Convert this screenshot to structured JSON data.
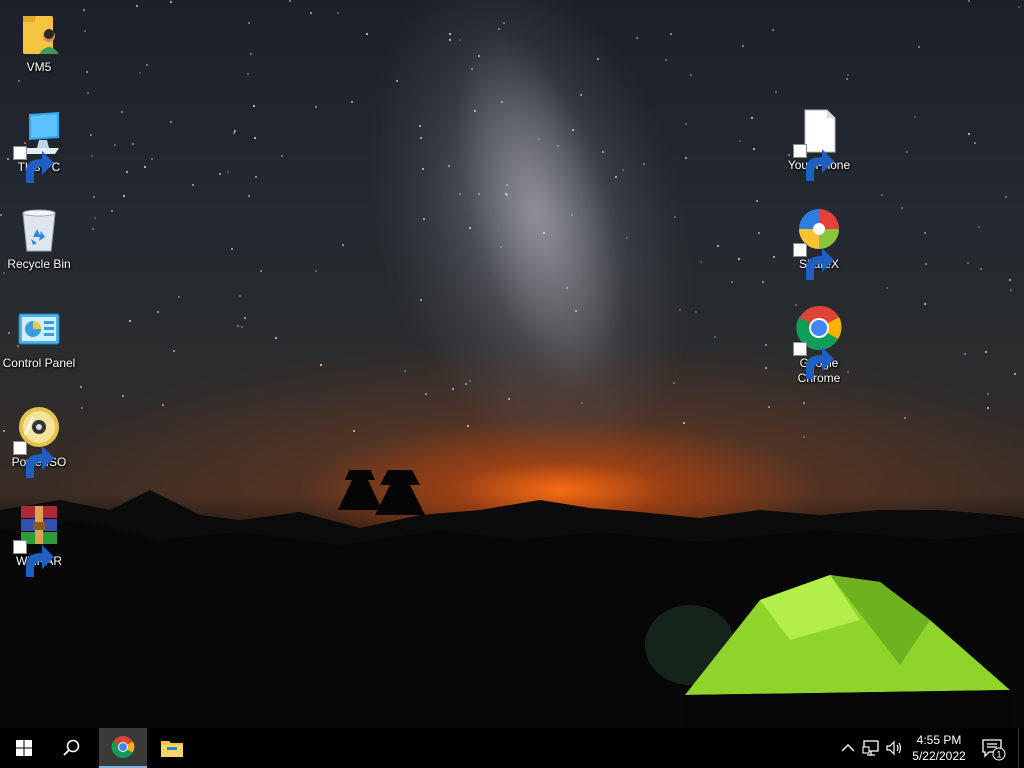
{
  "desktop": {
    "icons": [
      {
        "label": "VM5",
        "icon": "user-folder-icon"
      },
      {
        "label": "This PC",
        "icon": "computer-icon"
      },
      {
        "label": "Recycle Bin",
        "icon": "recycle-bin-icon"
      },
      {
        "label": "Control Panel",
        "icon": "control-panel-icon"
      },
      {
        "label": "PowerISO",
        "icon": "poweriso-disc-icon"
      },
      {
        "label": "WinRAR",
        "icon": "winrar-books-icon"
      },
      {
        "label": "Your Phone",
        "icon": "blank-file-icon"
      },
      {
        "label": "ShareX",
        "icon": "sharex-icon"
      },
      {
        "label": "Google Chrome",
        "icon": "chrome-icon"
      }
    ]
  },
  "taskbar": {
    "start": "windows-logo-icon",
    "search": "search-icon",
    "pinned": [
      "chrome-icon",
      "file-explorer-icon"
    ],
    "tray": {
      "icons": [
        "chevron-up-icon",
        "network-icon",
        "volume-icon"
      ],
      "time": "4:55 PM",
      "date": "5/22/2022",
      "notification_count": "1"
    }
  },
  "colors": {
    "taskbar": "#000000",
    "active_indicator": "#7fb3e0",
    "chrome_red": "#db4437",
    "chrome_yellow": "#f4b400",
    "chrome_green": "#0f9d58",
    "chrome_blue": "#4285f4",
    "tent_green": "#9ae22e"
  }
}
